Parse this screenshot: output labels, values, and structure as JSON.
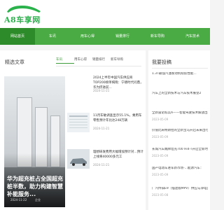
{
  "site": {
    "logo_text": "A8车享网",
    "brand_color": "#2bb24c"
  },
  "nav": {
    "items": [
      {
        "label": "网站首页",
        "active": true
      },
      {
        "label": "车讯",
        "active": false
      },
      {
        "label": "用车心得",
        "active": false
      },
      {
        "label": "销量排行",
        "active": false
      },
      {
        "label": "新车导购",
        "active": false
      },
      {
        "label": "汽车技术",
        "active": false
      }
    ],
    "accent": "#4aaa44"
  },
  "featured": {
    "section_title": "精选文章",
    "tabs": [
      "车讯",
      "用车心得",
      "销量排行",
      "新车导购"
    ],
    "hero": {
      "title": "华为超充桩占全国超充桩半数，助力构建智慧补能服务...",
      "date": "2024-11-22",
      "source": "企业"
    },
    "articles": [
      {
        "title": "2024上半年中国汽车供应商TOP200榜单揭晓：宁德时代问鼎，华为挤进前...",
        "date": "2024-11-21"
      },
      {
        "title": "11月车敏调查显示55.1%，乘用车零售预计年比达248万辆",
        "date": "2024-11-21"
      },
      {
        "title": "理想研发费用大幅增加预计对...预计上线将40000多元工",
        "date": "2024-11-21"
      }
    ]
  },
  "recommend": {
    "section_title": "我要投稿",
    "items": [
      {
        "title": "1.3T最强汽油发动机续航性能...",
        "date": ""
      },
      {
        "title": "汽车上的全新技术与汽车技术展望2",
        "date": ""
      },
      {
        "title": "全新雷诺标兵A——智能驾驶技术解放出行XX...",
        "date": "2023-05-09"
      },
      {
        "title": "价值比肩特斯拉的全新宝马开启未来出行模...",
        "date": "2023-05-09"
      },
      {
        "title": "长城汽车魏牌坦克700 Hi4-T开启全新时代...",
        "date": "2023-05-09"
      },
      {
        "title": "国产电动车进军新市场-...能源汽车：",
        "date": "2023-05-09"
      },
      {
        "title": "广汽传祺E9（插混版MPV）供应与净电卖...",
        "date": "2023-05-08"
      }
    ]
  }
}
